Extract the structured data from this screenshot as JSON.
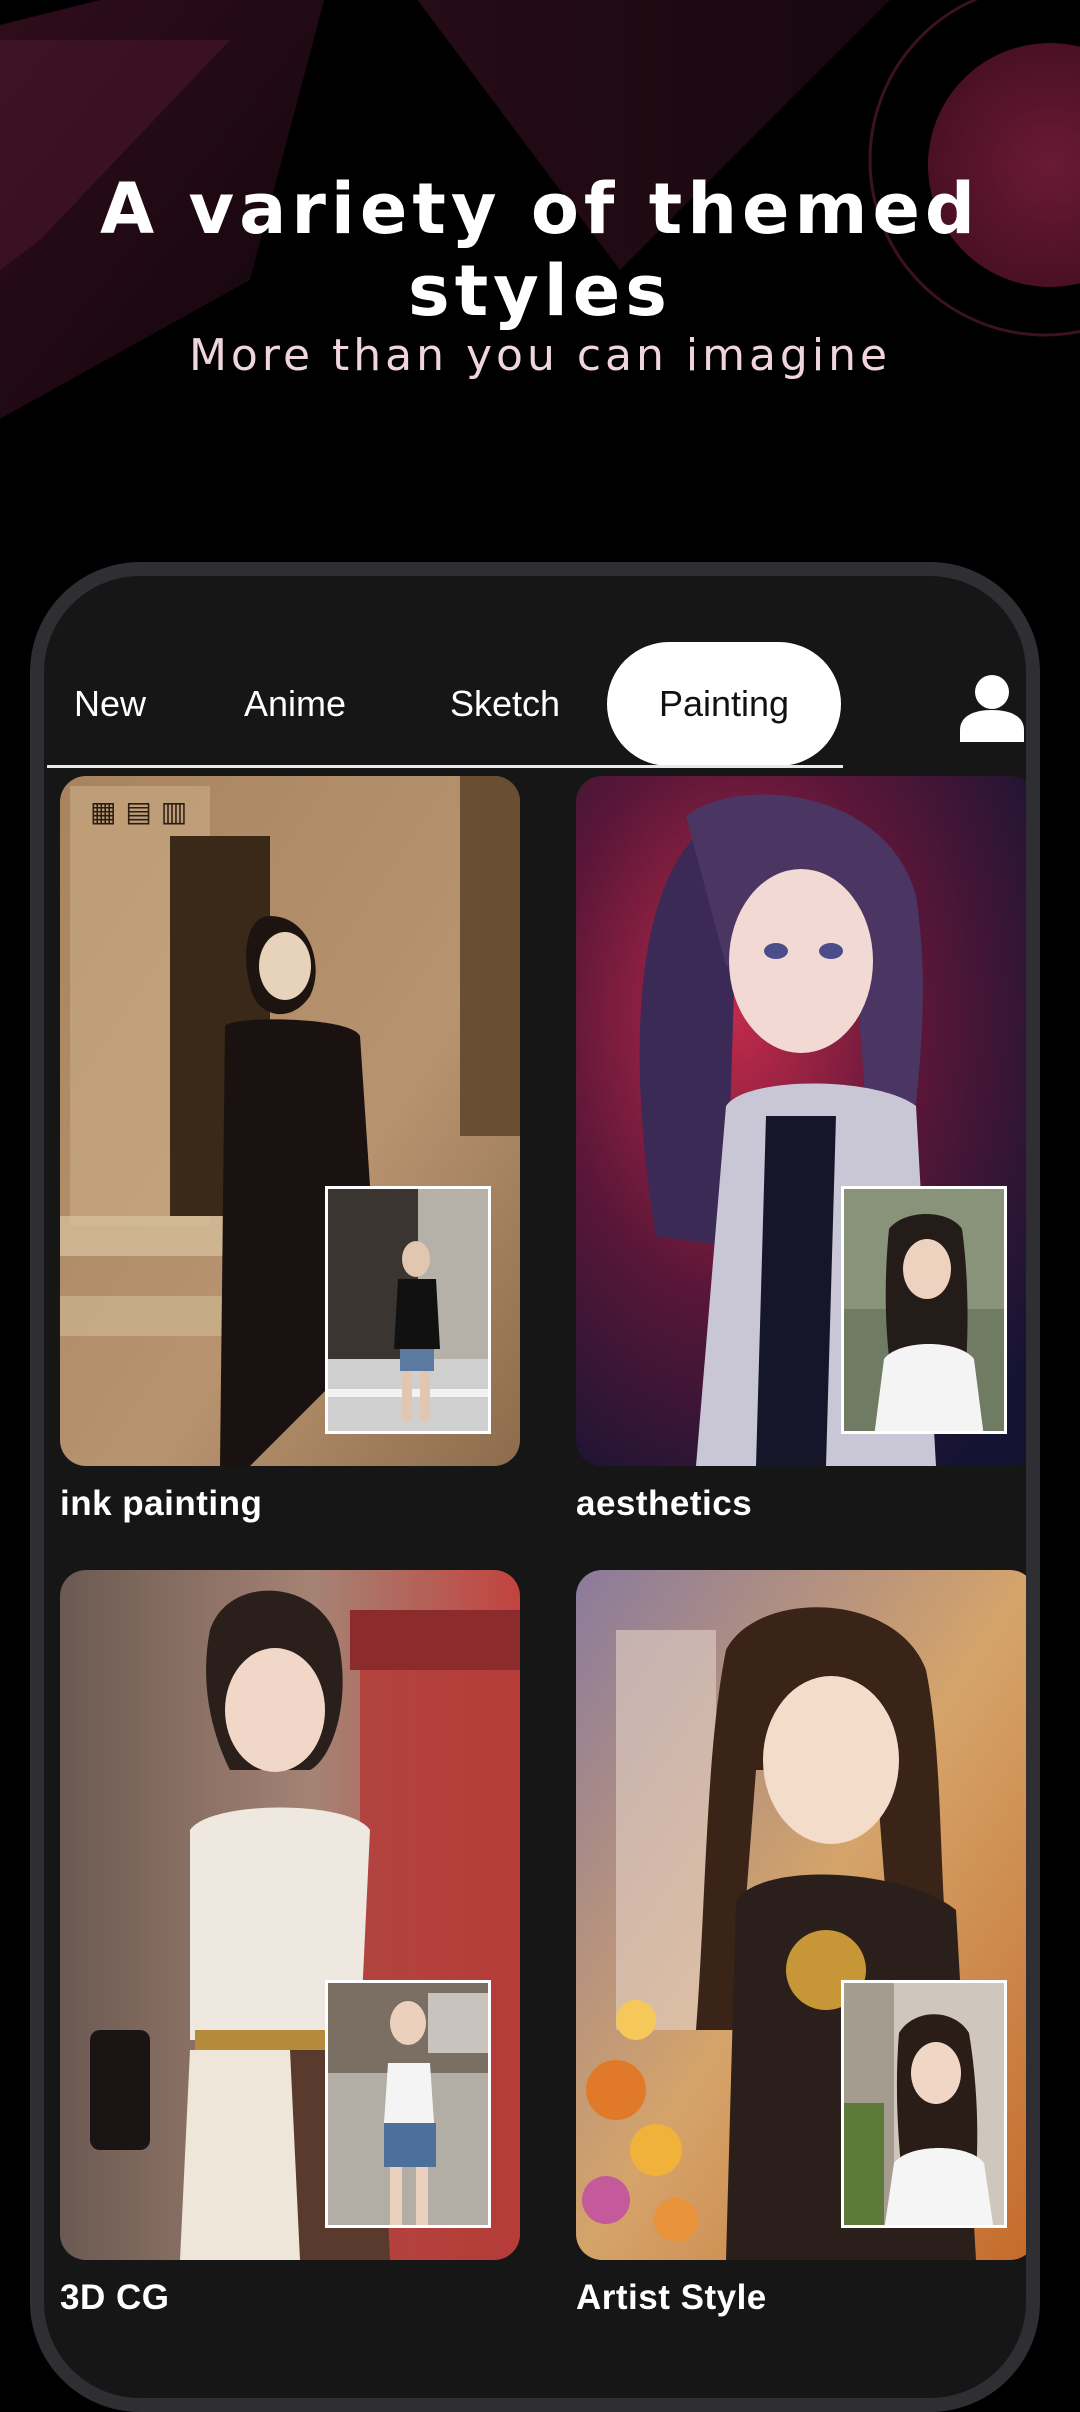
{
  "hero": {
    "title": "A variety of themed styles",
    "subtitle": "More than you can imagine"
  },
  "tabs": [
    {
      "label": "New"
    },
    {
      "label": "Anime"
    },
    {
      "label": "Sketch"
    },
    {
      "label": "Painting",
      "selected": true
    }
  ],
  "profile_icon": "person-icon",
  "styles": [
    {
      "label": "ink painting",
      "palette": "sepia"
    },
    {
      "label": "aesthetics",
      "palette": "crimson-violet"
    },
    {
      "label": "3D CG",
      "palette": "rose"
    },
    {
      "label": "Artist Style",
      "palette": "amber-floral"
    }
  ],
  "colors": {
    "background": "#000000",
    "phone_frame": "#2f2f33",
    "phone_screen": "#161616",
    "accent_magenta": "#7a1f3c",
    "tab_active_bg": "#ffffff"
  }
}
